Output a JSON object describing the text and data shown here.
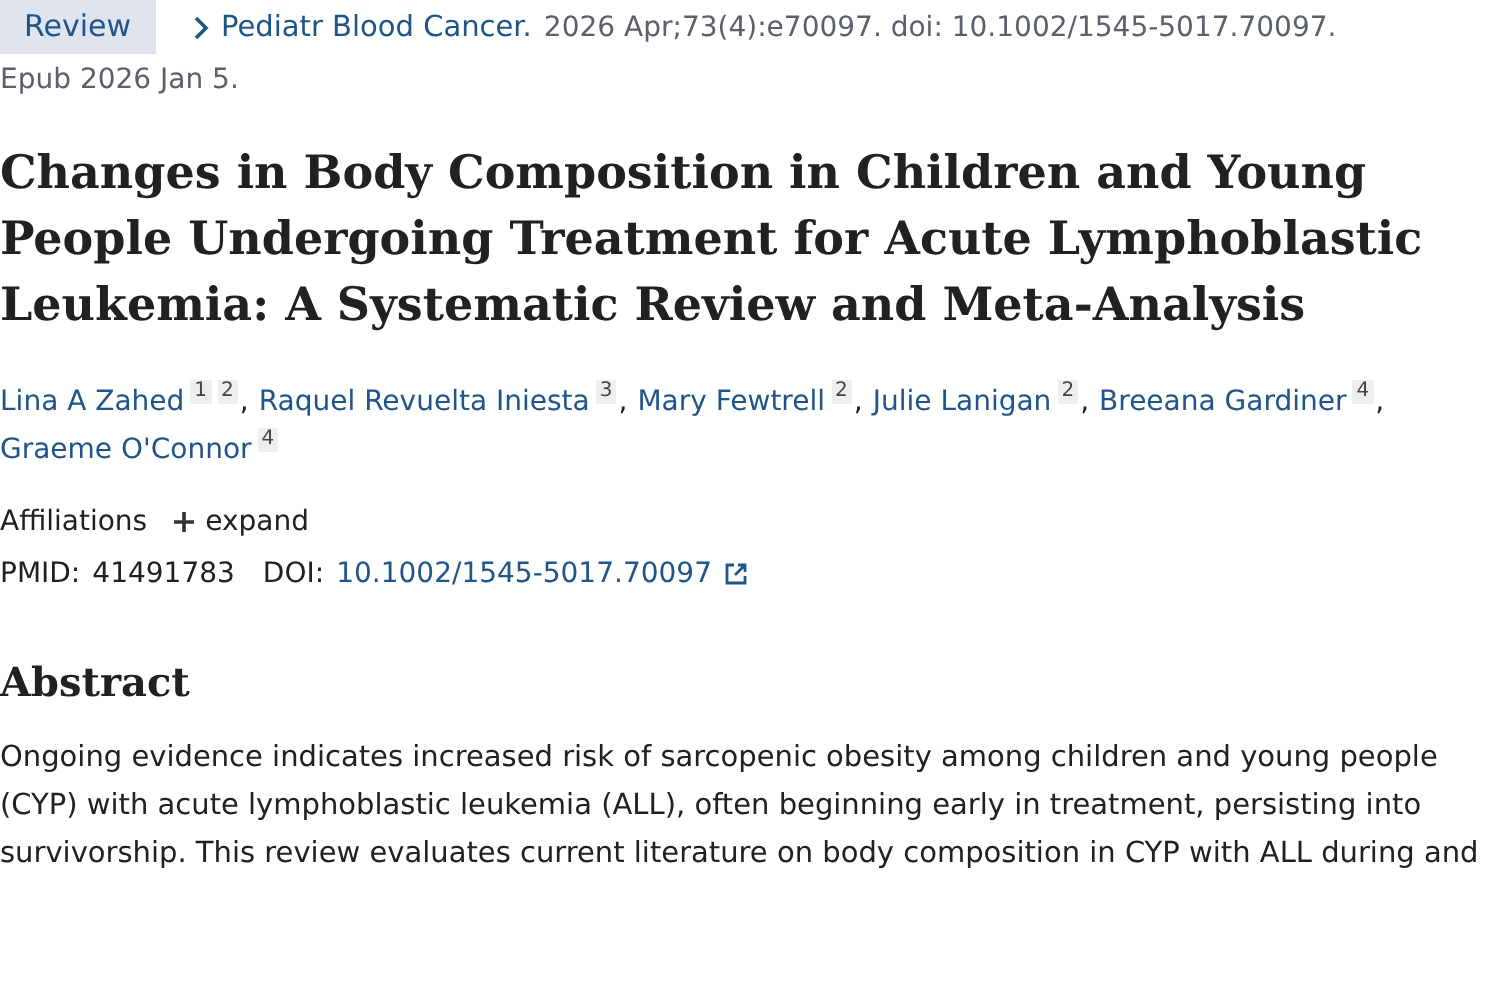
{
  "citation": {
    "badge": "Review",
    "journal": "Pediatr Blood Cancer.",
    "details": "2026 Apr;73(4):e70097. doi: 10.1002/1545-5017.70097.",
    "epub": "Epub 2026 Jan 5."
  },
  "title": "Changes in Body Composition in Children and Young People Undergoing Treatment for Acute Lymphoblastic Leukemia: A Systematic Review and Meta-Analysis",
  "authors": [
    {
      "name": "Lina A Zahed",
      "affiliations": [
        "1",
        "2"
      ],
      "separator": ","
    },
    {
      "name": "Raquel Revuelta Iniesta",
      "affiliations": [
        "3"
      ],
      "separator": ","
    },
    {
      "name": "Mary Fewtrell",
      "affiliations": [
        "2"
      ],
      "separator": ","
    },
    {
      "name": "Julie Lanigan",
      "affiliations": [
        "2"
      ],
      "separator": ","
    },
    {
      "name": "Breeana Gardiner",
      "affiliations": [
        "4"
      ],
      "separator": ","
    },
    {
      "name": "Graeme O'Connor",
      "affiliations": [
        "4"
      ]
    }
  ],
  "affiliations": {
    "label": "Affiliations",
    "toggle": "expand",
    "expanded": false
  },
  "ids": {
    "pmid_label": "PMID:",
    "pmid": "41491783",
    "doi_label": "DOI:",
    "doi": "10.1002/1545-5017.70097"
  },
  "abstract": {
    "heading": "Abstract",
    "text": "Ongoing evidence indicates increased risk of sarcopenic obesity among children and young people (CYP) with acute lymphoblastic leukemia (ALL), often beginning early in treatment, persisting into survivorship. This review evaluates current literature on body composition in CYP with ALL during and"
  }
}
